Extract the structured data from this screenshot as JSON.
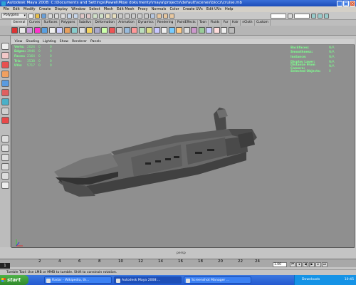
{
  "window": {
    "title": "Autodesk Maya 2008: C:\\Documents and Settings\\Pawel\\Moje dokumenty\\maya\\projects\\default\\scenes\\biccz\\cruise.mb",
    "controls": [
      "_",
      "□",
      "×"
    ]
  },
  "menubar": [
    "File",
    "Edit",
    "Modify",
    "Create",
    "Display",
    "Window",
    "Select",
    "Mesh",
    "Edit Mesh",
    "Proxy",
    "Normals",
    "Color",
    "Create UVs",
    "Edit UVs",
    "Help"
  ],
  "status_line": {
    "mode": "Polygons"
  },
  "shelf_tabs": [
    "General",
    "Curves",
    "Surfaces",
    "Polygons",
    "Subdivs",
    "Deformation",
    "Animation",
    "Dynamics",
    "Rendering",
    "PaintEffects",
    "Toon",
    "Fluids",
    "Fur",
    "Hair",
    "nCloth",
    "Custom"
  ],
  "shelf_active": "General",
  "panel_menu": [
    "View",
    "Shading",
    "Lighting",
    "Show",
    "Renderer",
    "Panels"
  ],
  "hud_left": [
    {
      "label": "Verts:",
      "values": [
        "2024",
        "0",
        "0"
      ]
    },
    {
      "label": "Edges:",
      "values": [
        "3946",
        "0",
        "0"
      ]
    },
    {
      "label": "Faces:",
      "values": [
        "2164",
        "0",
        "0"
      ]
    },
    {
      "label": "Tris:",
      "values": [
        "3538",
        "0",
        "0"
      ]
    },
    {
      "label": "UVs:",
      "values": [
        "5717",
        "0",
        "0"
      ]
    }
  ],
  "hud_right": [
    {
      "label": "Backfaces:",
      "value": "N/A"
    },
    {
      "label": "Smoothness:",
      "value": "N/A"
    },
    {
      "label": "Instance:",
      "value": "N/A"
    },
    {
      "label": "Display Layer:",
      "value": "N/A"
    },
    {
      "label": "Distance From Camera:",
      "value": "N/A"
    },
    {
      "label": "Selected Objects:",
      "value": "0"
    }
  ],
  "camera_label": "persp",
  "timeline": {
    "current_frame": "1",
    "ticks": [
      "2",
      "4",
      "6",
      "8",
      "10",
      "12",
      "14",
      "16",
      "18",
      "20",
      "22",
      "24"
    ],
    "range_value": "1.00"
  },
  "help_line": "Tumble Tool: Use LMB or MMB to tumble. Shift to constrain rotation.",
  "taskbar": {
    "start": "start",
    "tasks": [
      "Radar - Wikipedia, th...",
      "Autodesk Maya 2008:...",
      "Screenshot Manager ..."
    ],
    "tray_text": "Downloads",
    "clock": "10:45"
  },
  "colors": {
    "viewport_bg": "#8f8f8f",
    "hud_text": "#7dff8e",
    "taskbar_blue": "#245ad0",
    "start_green": "#3a9a35"
  }
}
